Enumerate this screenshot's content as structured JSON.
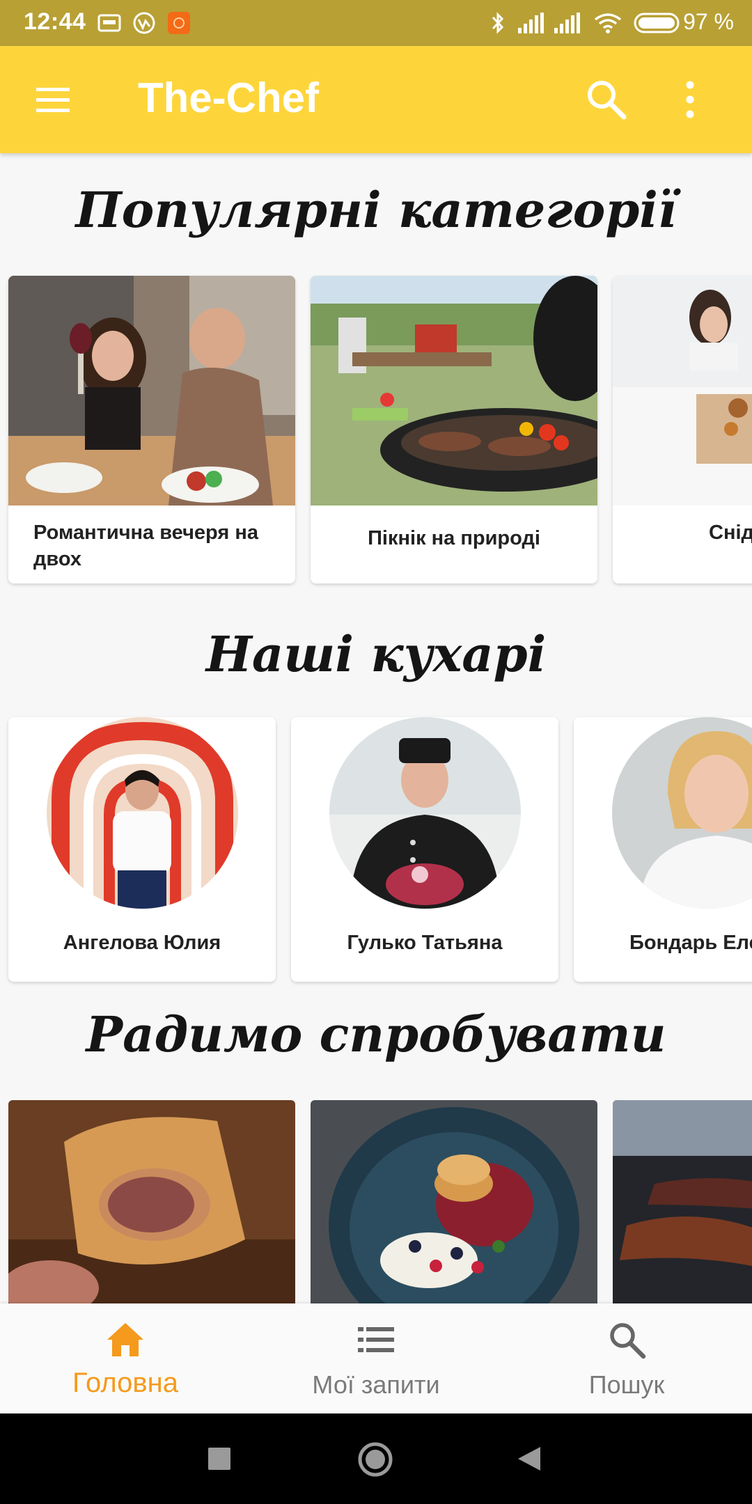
{
  "status_bar": {
    "time": "12:44",
    "battery": "97 %",
    "icons": [
      "vpn-key-icon",
      "vitality-icon",
      "app-notification-icon",
      "bluetooth-icon",
      "signal-icon",
      "signal-icon",
      "wifi-icon",
      "battery-icon"
    ]
  },
  "appbar": {
    "title": "The-Chef",
    "icons": [
      "menu-icon",
      "search-icon",
      "more-vert-icon"
    ],
    "color": "#fdd53b"
  },
  "sections": {
    "popular_title": "Популярні категорії",
    "chefs_title": "Наші кухарі",
    "try_title": "Радимо спробувати"
  },
  "categories": [
    {
      "label": "Романтична вечеря на двох"
    },
    {
      "label": "Пікнік на природі"
    },
    {
      "label": "Снід"
    }
  ],
  "chefs": [
    {
      "name": "Ангелова Юлия"
    },
    {
      "name": "Гулько Татьяна"
    },
    {
      "name": "Бондарь Еле"
    }
  ],
  "bottom_nav": {
    "items": [
      {
        "label": "Головна",
        "icon": "home-icon",
        "active": true
      },
      {
        "label": "Мої запити",
        "icon": "list-icon",
        "active": false
      },
      {
        "label": "Пошук",
        "icon": "search-icon",
        "active": false
      }
    ],
    "active_color": "#f59a1c"
  },
  "system_nav": {
    "icons": [
      "recents-square-icon",
      "home-circle-icon",
      "back-triangle-icon"
    ]
  }
}
